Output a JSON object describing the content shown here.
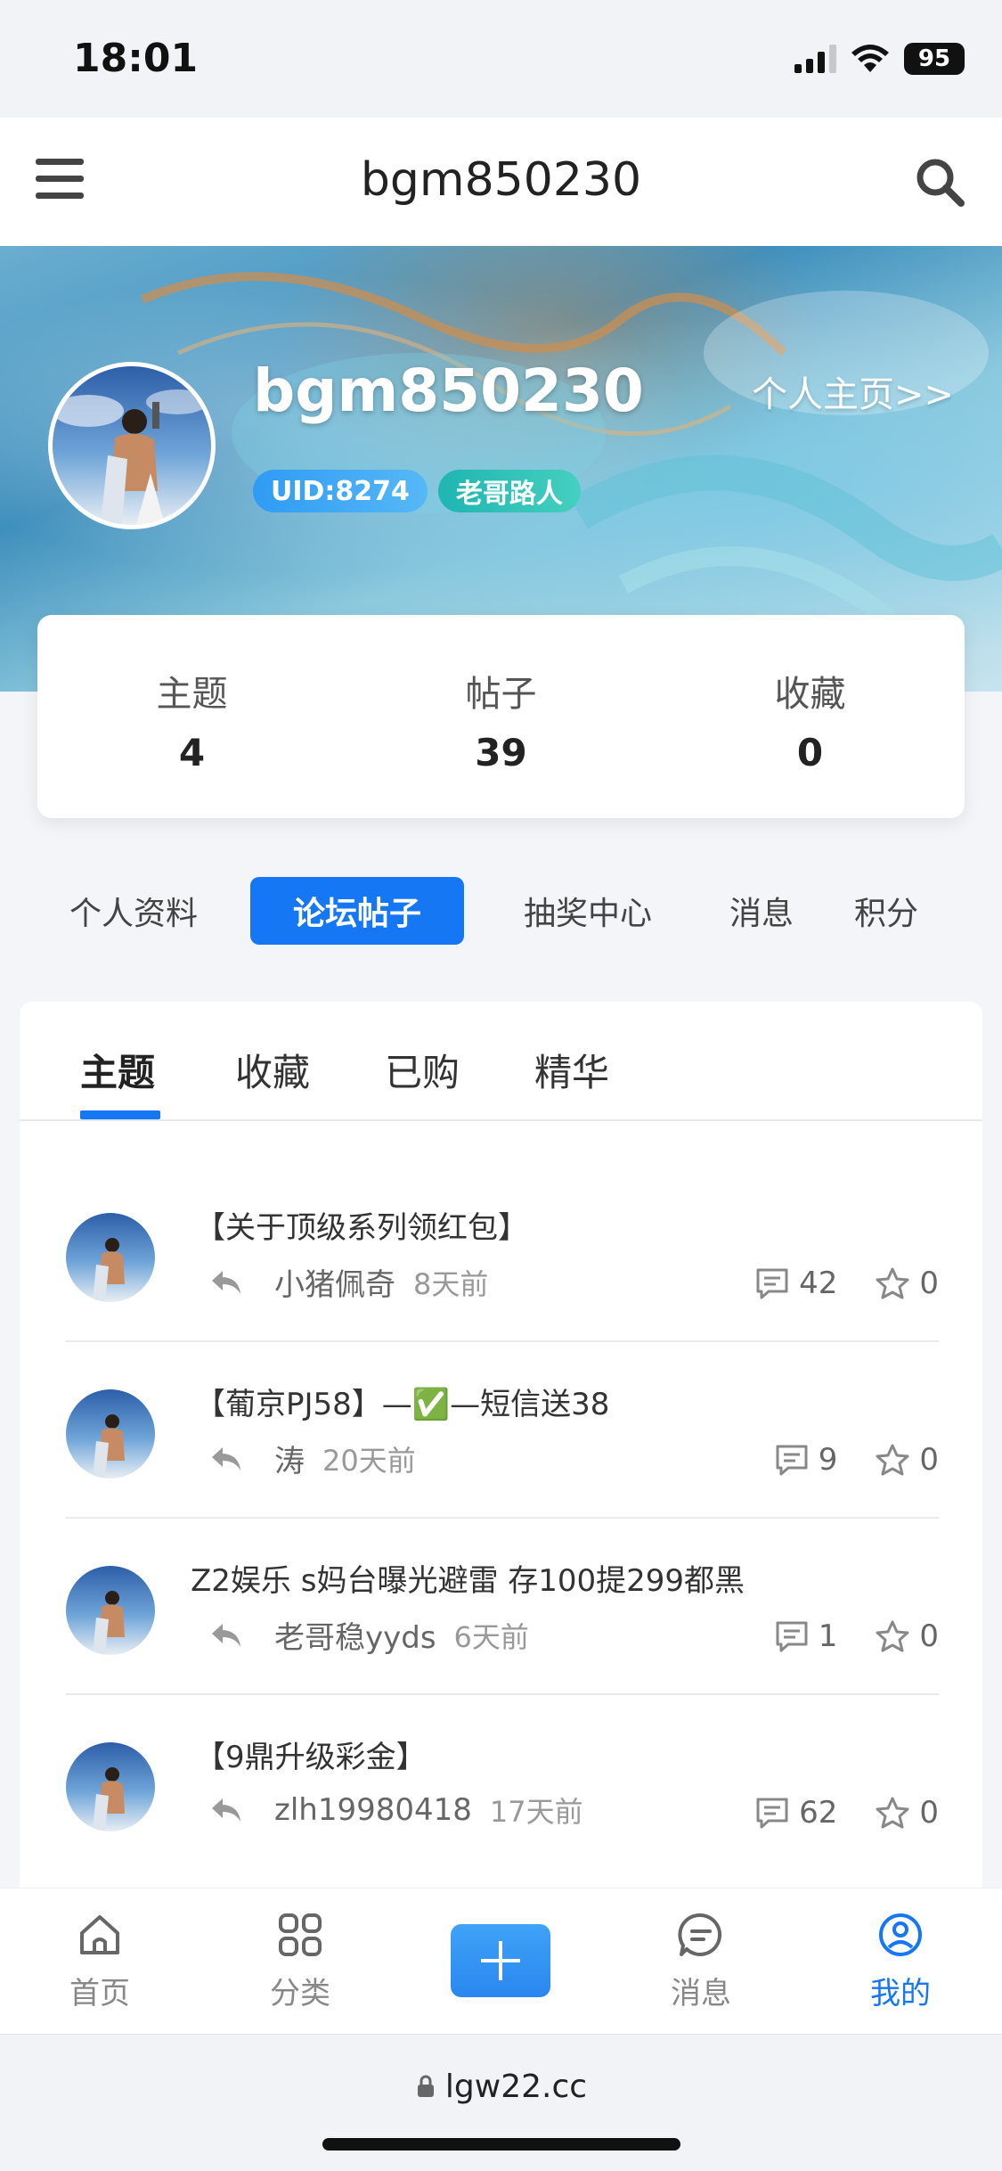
{
  "status_bar": {
    "time": "18:01",
    "battery": "95"
  },
  "header": {
    "title": "bgm850230"
  },
  "profile": {
    "name": "bgm850230",
    "homepage_link": "个人主页>>",
    "uid_badge": "UID:8274",
    "rank_badge": "老哥路人"
  },
  "stats": [
    {
      "label": "主题",
      "value": "4"
    },
    {
      "label": "帖子",
      "value": "39"
    },
    {
      "label": "收藏",
      "value": "0"
    }
  ],
  "pill_nav": [
    "个人资料",
    "论坛帖子",
    "抽奖中心",
    "消息",
    "积分"
  ],
  "pill_nav_active": "论坛帖子",
  "tabs": [
    "主题",
    "收藏",
    "已购",
    "精华"
  ],
  "tabs_active": "主题",
  "posts": [
    {
      "title": "【关于顶级系列领红包】",
      "author": "小猪佩奇",
      "time": "8天前",
      "comments": "42",
      "favorites": "0"
    },
    {
      "title": "【葡京PJ58】—✅—短信送38",
      "author": "涛",
      "time": "20天前",
      "comments": "9",
      "favorites": "0"
    },
    {
      "title": "Z2娱乐 s妈台曝光避雷 存100提299都黑",
      "author": "老哥稳yyds",
      "time": "6天前",
      "comments": "1",
      "favorites": "0"
    },
    {
      "title": "【9鼎升级彩金】",
      "author": "zlh19980418",
      "time": "17天前",
      "comments": "62",
      "favorites": "0"
    }
  ],
  "bottom_nav": [
    {
      "label": "首页",
      "icon": "home-icon"
    },
    {
      "label": "分类",
      "icon": "grid-icon"
    },
    {
      "label": "",
      "icon": "plus-icon"
    },
    {
      "label": "消息",
      "icon": "message-icon"
    },
    {
      "label": "我的",
      "icon": "user-icon"
    }
  ],
  "bottom_nav_active": "我的",
  "browser": {
    "url": "lgw22.cc"
  },
  "colors": {
    "accent": "#1677f4",
    "uid_badge": "#3aa6f5",
    "rank_badge": "#2cc0b5"
  }
}
